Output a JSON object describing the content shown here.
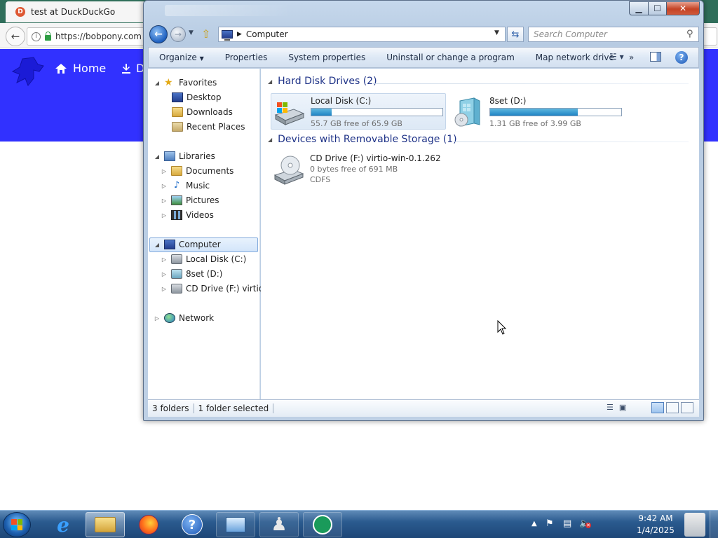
{
  "browser": {
    "tab_title": "test at DuckDuckGo",
    "url": "https://bobpony.com",
    "site_nav": {
      "home": "Home",
      "download": "D"
    }
  },
  "explorer": {
    "address": "Computer",
    "search_placeholder": "Search Computer",
    "toolbar": {
      "organize": "Organize",
      "properties": "Properties",
      "system_properties": "System properties",
      "uninstall": "Uninstall or change a program",
      "map_drive": "Map network drive",
      "more": "»"
    },
    "nav": {
      "favorites": "Favorites",
      "desktop": "Desktop",
      "downloads": "Downloads",
      "recent_places": "Recent Places",
      "libraries": "Libraries",
      "documents": "Documents",
      "music": "Music",
      "pictures": "Pictures",
      "videos": "Videos",
      "computer": "Computer",
      "local_disk": "Local Disk (C:)",
      "eightset": "8set (D:)",
      "cd_drive": "CD Drive (F:) virtio-w",
      "network": "Network"
    },
    "groups": {
      "hdd": "Hard Disk Drives (2)",
      "removable": "Devices with Removable Storage (1)"
    },
    "drives": [
      {
        "name": "Local Disk (C:)",
        "free": "55.7 GB free of 65.9 GB",
        "used_fraction": 0.155
      },
      {
        "name": "8set (D:)",
        "free": "1.31 GB free of 3.99 GB",
        "used_fraction": 0.67
      },
      {
        "name": "CD Drive (F:) virtio-win-0.1.262",
        "free": "0 bytes free of 691 MB",
        "fs": "CDFS"
      }
    ],
    "status": {
      "count": "3 folders",
      "selected": "1 folder selected"
    }
  },
  "taskbar": {
    "time": "9:42 AM",
    "date": "1/4/2025"
  },
  "colors": {
    "banner": "#3131ff",
    "accent": "#1e3287",
    "taskbar": "#2b5b8f"
  }
}
